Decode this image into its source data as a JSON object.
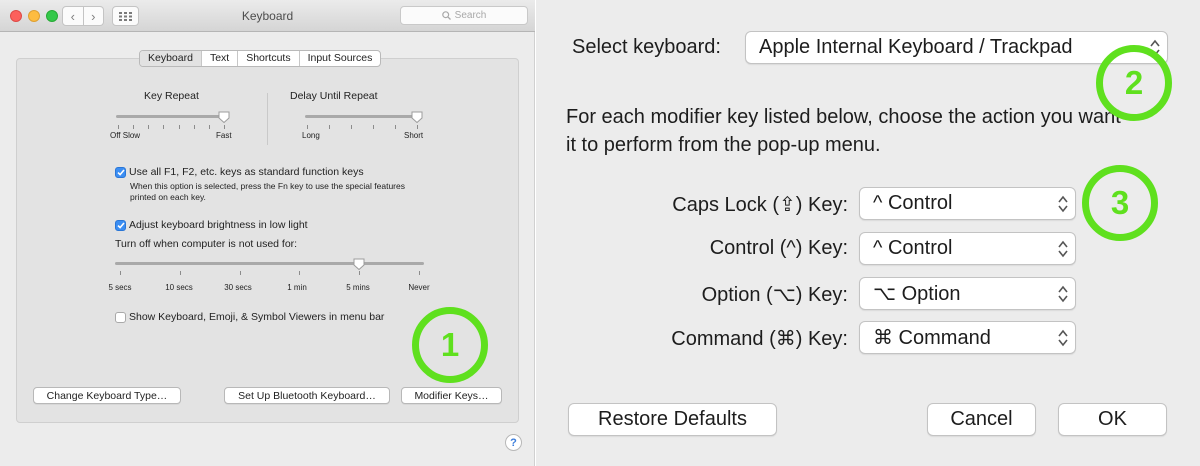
{
  "window": {
    "title": "Keyboard",
    "search_placeholder": "Search",
    "nav_back": "‹",
    "nav_forward": "›"
  },
  "tabs": [
    "Keyboard",
    "Text",
    "Shortcuts",
    "Input Sources"
  ],
  "selected_tab": "Keyboard",
  "key_repeat": {
    "title": "Key Repeat",
    "left": "Off Slow",
    "right": "Fast",
    "level": 1.0
  },
  "delay_until_repeat": {
    "title": "Delay Until Repeat",
    "left": "Long",
    "right": "Short",
    "level": 1.0
  },
  "fn_keys": {
    "label": "Use all F1, F2, etc. keys as standard function keys",
    "description": "When this option is selected, press the Fn key to use the special features printed on each key.",
    "checked": true
  },
  "brightness": {
    "label": "Adjust keyboard brightness in low light",
    "checked": true
  },
  "turn_off": {
    "label": "Turn off when computer is not used for:",
    "ticks": [
      "5 secs",
      "10 secs",
      "30 secs",
      "1 min",
      "5 mins",
      "Never"
    ],
    "selected": "5 mins"
  },
  "viewers": {
    "label": "Show Keyboard, Emoji, & Symbol Viewers in menu bar",
    "checked": false
  },
  "buttons": {
    "change_type": "Change Keyboard Type…",
    "bluetooth": "Set Up Bluetooth Keyboard…",
    "modifier": "Modifier Keys…",
    "help": "?"
  },
  "dialog": {
    "select_label": "Select keyboard:",
    "select_value": "Apple Internal Keyboard / Trackpad",
    "instruction": "For each modifier key listed below, choose the action you want it to perform from the pop-up menu.",
    "rows": [
      {
        "label": "Caps Lock (⇪) Key:",
        "value": "^ Control"
      },
      {
        "label": "Control (^) Key:",
        "value": "^ Control"
      },
      {
        "label": "Option (⌥) Key:",
        "value": "⌥ Option"
      },
      {
        "label": "Command (⌘) Key:",
        "value": "⌘ Command"
      }
    ],
    "restore": "Restore Defaults",
    "cancel": "Cancel",
    "ok": "OK"
  },
  "markers": [
    "1",
    "2",
    "3"
  ],
  "colors": {
    "marker": "#5fe01e",
    "checkbox": "#3b8ef3"
  }
}
